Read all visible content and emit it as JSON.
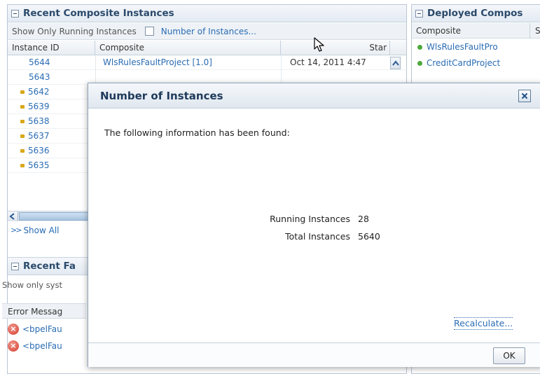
{
  "instances_panel": {
    "title": "Recent Composite Instances",
    "filter_label": "Show Only Running Instances",
    "count_link": "Number of Instances...",
    "columns": [
      "Instance ID",
      "Composite",
      "Star"
    ],
    "rows": [
      {
        "id": "5644",
        "composite": "WlsRulesFaultProject [1.0]",
        "start": "Oct 14, 2011 4:47",
        "bullet": false
      },
      {
        "id": "5643",
        "composite": "",
        "start": "",
        "bullet": false
      },
      {
        "id": "5642",
        "composite": "",
        "start": "",
        "bullet": true
      },
      {
        "id": "5639",
        "composite": "",
        "start": "",
        "bullet": true
      },
      {
        "id": "5638",
        "composite": "",
        "start": "",
        "bullet": true
      },
      {
        "id": "5637",
        "composite": "",
        "start": "",
        "bullet": true
      },
      {
        "id": "5636",
        "composite": "",
        "start": "",
        "bullet": true
      },
      {
        "id": "5635",
        "composite": "",
        "start": "",
        "bullet": true
      }
    ],
    "show_all": "Show All"
  },
  "faults_panel": {
    "title": "Recent Fa",
    "filter_text": "Show only syst",
    "column": "Error Messag",
    "rows": [
      "<bpelFau",
      "<bpelFau"
    ]
  },
  "deployed_panel": {
    "title": "Deployed Compos",
    "column": "Composite",
    "column2": "S",
    "rows": [
      "WlsRulesFaultPro",
      "CreditCardProject"
    ]
  },
  "dialog": {
    "title": "Number of Instances",
    "message": "The following information has been found:",
    "stats": [
      {
        "label": "Running Instances",
        "value": "28"
      },
      {
        "label": "Total Instances",
        "value": "5640"
      }
    ],
    "recalculate": "Recalculate...",
    "ok": "OK"
  },
  "icons": {
    "collapse": "collapse-icon",
    "checkbox": "checkbox-icon",
    "bullet": "status-bullet-icon",
    "error": "error-icon",
    "running": "running-status-icon",
    "close": "close-icon",
    "cursor": "mouse-cursor-icon"
  },
  "colors": {
    "link": "#2a6cb3",
    "panel_title": "#2b4a6b",
    "bullet": "#d8a818",
    "running": "#4caa3c",
    "error": "#d23a2c"
  }
}
